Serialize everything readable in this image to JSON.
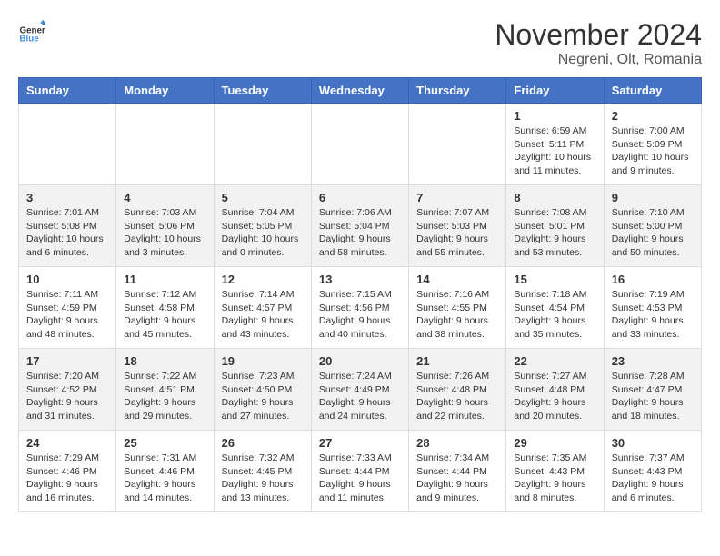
{
  "logo": {
    "text_general": "General",
    "text_blue": "Blue"
  },
  "header": {
    "month": "November 2024",
    "location": "Negreni, Olt, Romania"
  },
  "weekdays": [
    "Sunday",
    "Monday",
    "Tuesday",
    "Wednesday",
    "Thursday",
    "Friday",
    "Saturday"
  ],
  "weeks": [
    [
      {
        "day": "",
        "info": ""
      },
      {
        "day": "",
        "info": ""
      },
      {
        "day": "",
        "info": ""
      },
      {
        "day": "",
        "info": ""
      },
      {
        "day": "",
        "info": ""
      },
      {
        "day": "1",
        "info": "Sunrise: 6:59 AM\nSunset: 5:11 PM\nDaylight: 10 hours and 11 minutes."
      },
      {
        "day": "2",
        "info": "Sunrise: 7:00 AM\nSunset: 5:09 PM\nDaylight: 10 hours and 9 minutes."
      }
    ],
    [
      {
        "day": "3",
        "info": "Sunrise: 7:01 AM\nSunset: 5:08 PM\nDaylight: 10 hours and 6 minutes."
      },
      {
        "day": "4",
        "info": "Sunrise: 7:03 AM\nSunset: 5:06 PM\nDaylight: 10 hours and 3 minutes."
      },
      {
        "day": "5",
        "info": "Sunrise: 7:04 AM\nSunset: 5:05 PM\nDaylight: 10 hours and 0 minutes."
      },
      {
        "day": "6",
        "info": "Sunrise: 7:06 AM\nSunset: 5:04 PM\nDaylight: 9 hours and 58 minutes."
      },
      {
        "day": "7",
        "info": "Sunrise: 7:07 AM\nSunset: 5:03 PM\nDaylight: 9 hours and 55 minutes."
      },
      {
        "day": "8",
        "info": "Sunrise: 7:08 AM\nSunset: 5:01 PM\nDaylight: 9 hours and 53 minutes."
      },
      {
        "day": "9",
        "info": "Sunrise: 7:10 AM\nSunset: 5:00 PM\nDaylight: 9 hours and 50 minutes."
      }
    ],
    [
      {
        "day": "10",
        "info": "Sunrise: 7:11 AM\nSunset: 4:59 PM\nDaylight: 9 hours and 48 minutes."
      },
      {
        "day": "11",
        "info": "Sunrise: 7:12 AM\nSunset: 4:58 PM\nDaylight: 9 hours and 45 minutes."
      },
      {
        "day": "12",
        "info": "Sunrise: 7:14 AM\nSunset: 4:57 PM\nDaylight: 9 hours and 43 minutes."
      },
      {
        "day": "13",
        "info": "Sunrise: 7:15 AM\nSunset: 4:56 PM\nDaylight: 9 hours and 40 minutes."
      },
      {
        "day": "14",
        "info": "Sunrise: 7:16 AM\nSunset: 4:55 PM\nDaylight: 9 hours and 38 minutes."
      },
      {
        "day": "15",
        "info": "Sunrise: 7:18 AM\nSunset: 4:54 PM\nDaylight: 9 hours and 35 minutes."
      },
      {
        "day": "16",
        "info": "Sunrise: 7:19 AM\nSunset: 4:53 PM\nDaylight: 9 hours and 33 minutes."
      }
    ],
    [
      {
        "day": "17",
        "info": "Sunrise: 7:20 AM\nSunset: 4:52 PM\nDaylight: 9 hours and 31 minutes."
      },
      {
        "day": "18",
        "info": "Sunrise: 7:22 AM\nSunset: 4:51 PM\nDaylight: 9 hours and 29 minutes."
      },
      {
        "day": "19",
        "info": "Sunrise: 7:23 AM\nSunset: 4:50 PM\nDaylight: 9 hours and 27 minutes."
      },
      {
        "day": "20",
        "info": "Sunrise: 7:24 AM\nSunset: 4:49 PM\nDaylight: 9 hours and 24 minutes."
      },
      {
        "day": "21",
        "info": "Sunrise: 7:26 AM\nSunset: 4:48 PM\nDaylight: 9 hours and 22 minutes."
      },
      {
        "day": "22",
        "info": "Sunrise: 7:27 AM\nSunset: 4:48 PM\nDaylight: 9 hours and 20 minutes."
      },
      {
        "day": "23",
        "info": "Sunrise: 7:28 AM\nSunset: 4:47 PM\nDaylight: 9 hours and 18 minutes."
      }
    ],
    [
      {
        "day": "24",
        "info": "Sunrise: 7:29 AM\nSunset: 4:46 PM\nDaylight: 9 hours and 16 minutes."
      },
      {
        "day": "25",
        "info": "Sunrise: 7:31 AM\nSunset: 4:46 PM\nDaylight: 9 hours and 14 minutes."
      },
      {
        "day": "26",
        "info": "Sunrise: 7:32 AM\nSunset: 4:45 PM\nDaylight: 9 hours and 13 minutes."
      },
      {
        "day": "27",
        "info": "Sunrise: 7:33 AM\nSunset: 4:44 PM\nDaylight: 9 hours and 11 minutes."
      },
      {
        "day": "28",
        "info": "Sunrise: 7:34 AM\nSunset: 4:44 PM\nDaylight: 9 hours and 9 minutes."
      },
      {
        "day": "29",
        "info": "Sunrise: 7:35 AM\nSunset: 4:43 PM\nDaylight: 9 hours and 8 minutes."
      },
      {
        "day": "30",
        "info": "Sunrise: 7:37 AM\nSunset: 4:43 PM\nDaylight: 9 hours and 6 minutes."
      }
    ]
  ]
}
